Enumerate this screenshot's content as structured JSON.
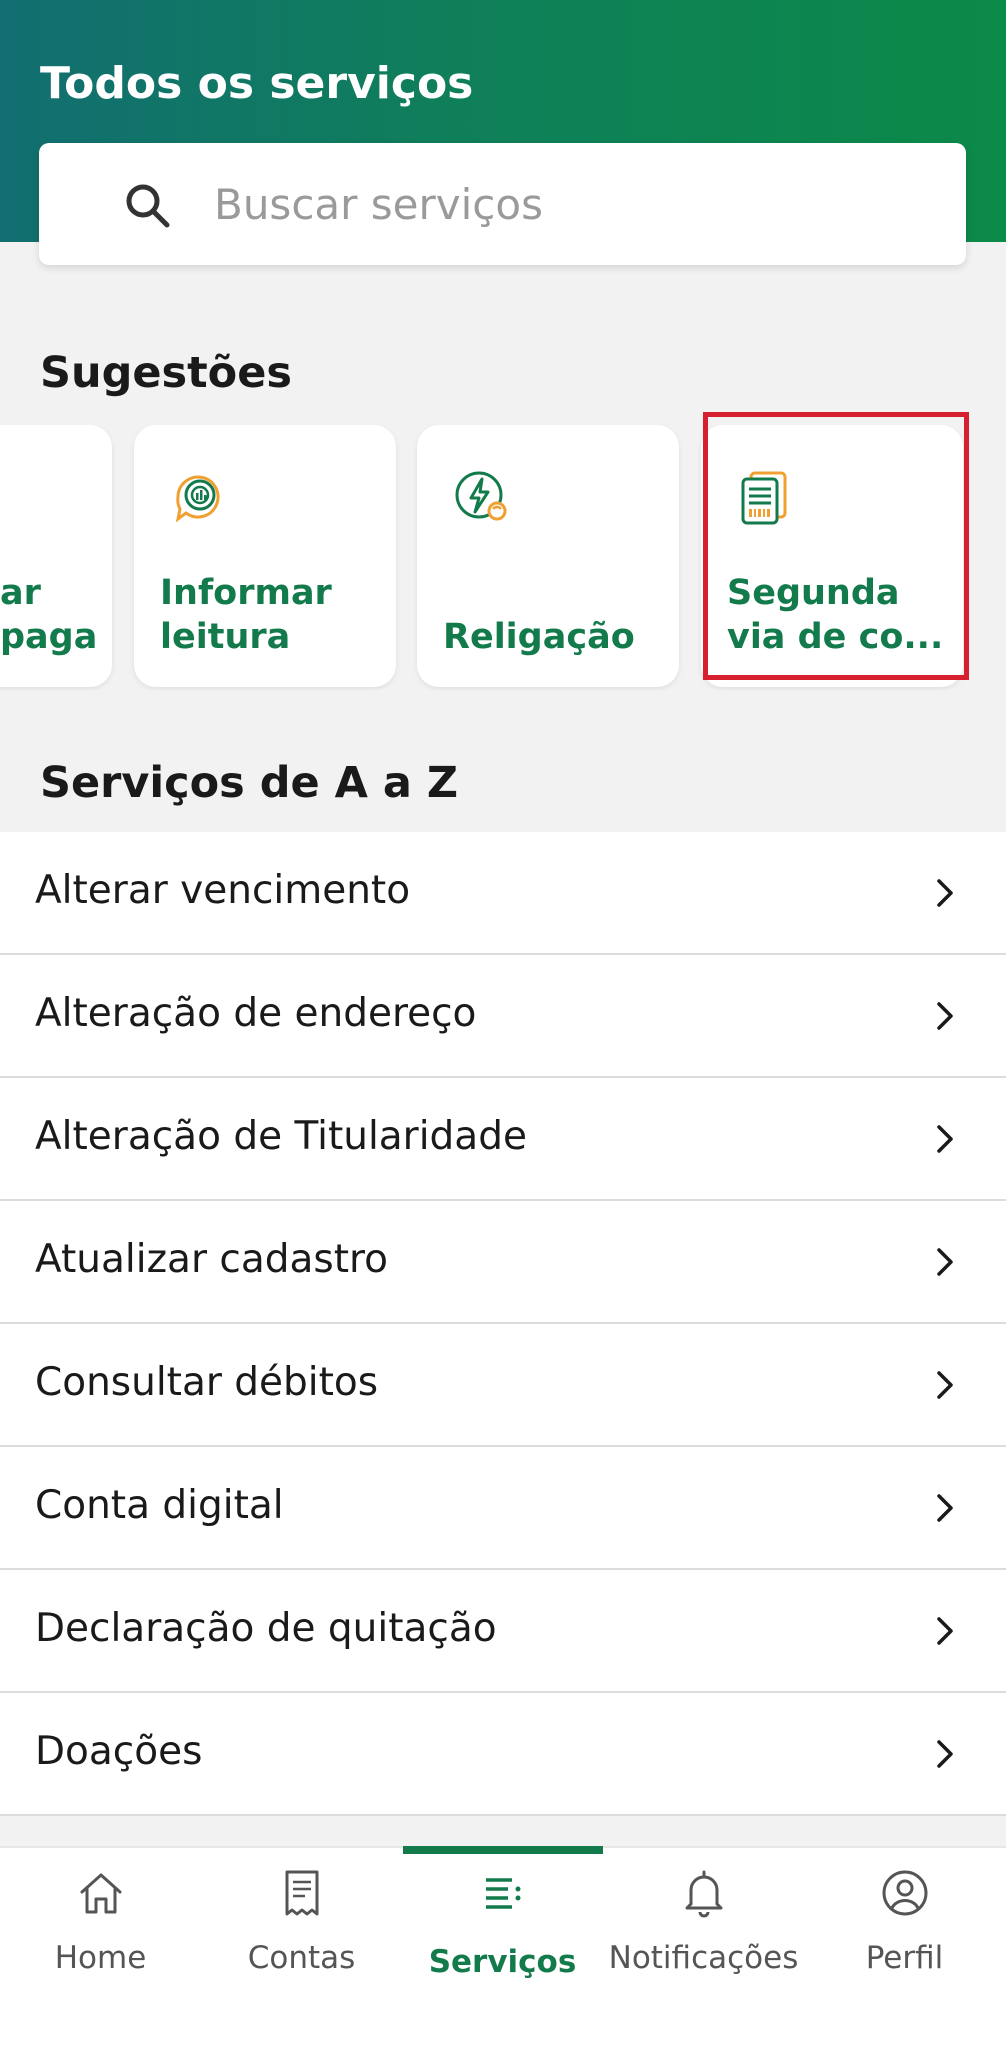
{
  "header": {
    "title": "Todos os serviços",
    "search": {
      "placeholder": "Buscar serviços",
      "value": ""
    }
  },
  "suggestions": {
    "title": "Sugestões",
    "cards": [
      {
        "label": "ar\npaga",
        "icon": "payment-icon"
      },
      {
        "label": "Informar\nleitura",
        "icon": "meter-reading-icon"
      },
      {
        "label": "Religação",
        "icon": "power-reconnect-icon"
      },
      {
        "label": "Segunda\nvia de co...",
        "icon": "bill-copy-icon"
      }
    ]
  },
  "az": {
    "title": "Serviços de A a Z",
    "items": [
      "Alterar vencimento",
      "Alteração de endereço",
      "Alteração de Titularidade",
      "Atualizar cadastro",
      "Consultar débitos",
      "Conta digital",
      "Declaração de quitação",
      "Doações"
    ]
  },
  "nav": {
    "items": [
      {
        "label": "Home",
        "icon": "home-icon"
      },
      {
        "label": "Contas",
        "icon": "receipt-icon"
      },
      {
        "label": "Serviços",
        "icon": "services-list-icon",
        "active": true
      },
      {
        "label": "Notificações",
        "icon": "bell-icon"
      },
      {
        "label": "Perfil",
        "icon": "profile-icon"
      }
    ]
  },
  "colors": {
    "brand_green": "#137a4c",
    "header_start": "#126e71",
    "header_end": "#0c8a48",
    "highlight": "#d6202f",
    "icon_orange": "#f0a030"
  }
}
